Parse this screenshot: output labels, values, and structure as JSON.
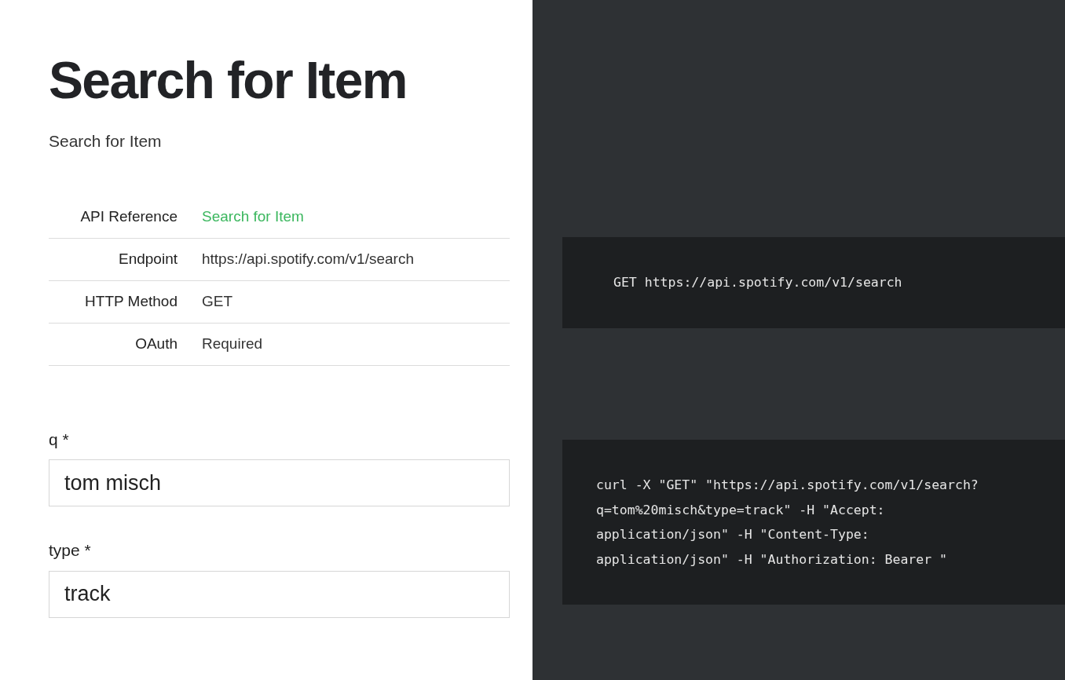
{
  "title": "Search for Item",
  "subtitle": "Search for Item",
  "info_table": [
    {
      "label": "API Reference",
      "value": "Search for Item",
      "kind": "link"
    },
    {
      "label": "Endpoint",
      "value": "https://api.spotify.com/v1/search",
      "kind": "text"
    },
    {
      "label": "HTTP Method",
      "value": "GET",
      "kind": "text"
    },
    {
      "label": "OAuth",
      "value": "Required",
      "kind": "text"
    }
  ],
  "fields": [
    {
      "label": "q *",
      "value": "tom misch"
    },
    {
      "label": "type *",
      "value": "track"
    }
  ],
  "code_blocks": [
    {
      "lines": [
        "GET https://api.spotify.com/v1/search"
      ]
    },
    {
      "lines": [
        "curl -X \"GET\" \"https://api.spotify.com/v1/search?",
        "q=tom%20misch&type=track\" -H \"Accept:",
        "application/json\" -H \"Content-Type:",
        "application/json\" -H \"Authorization: Bearer \""
      ]
    }
  ]
}
